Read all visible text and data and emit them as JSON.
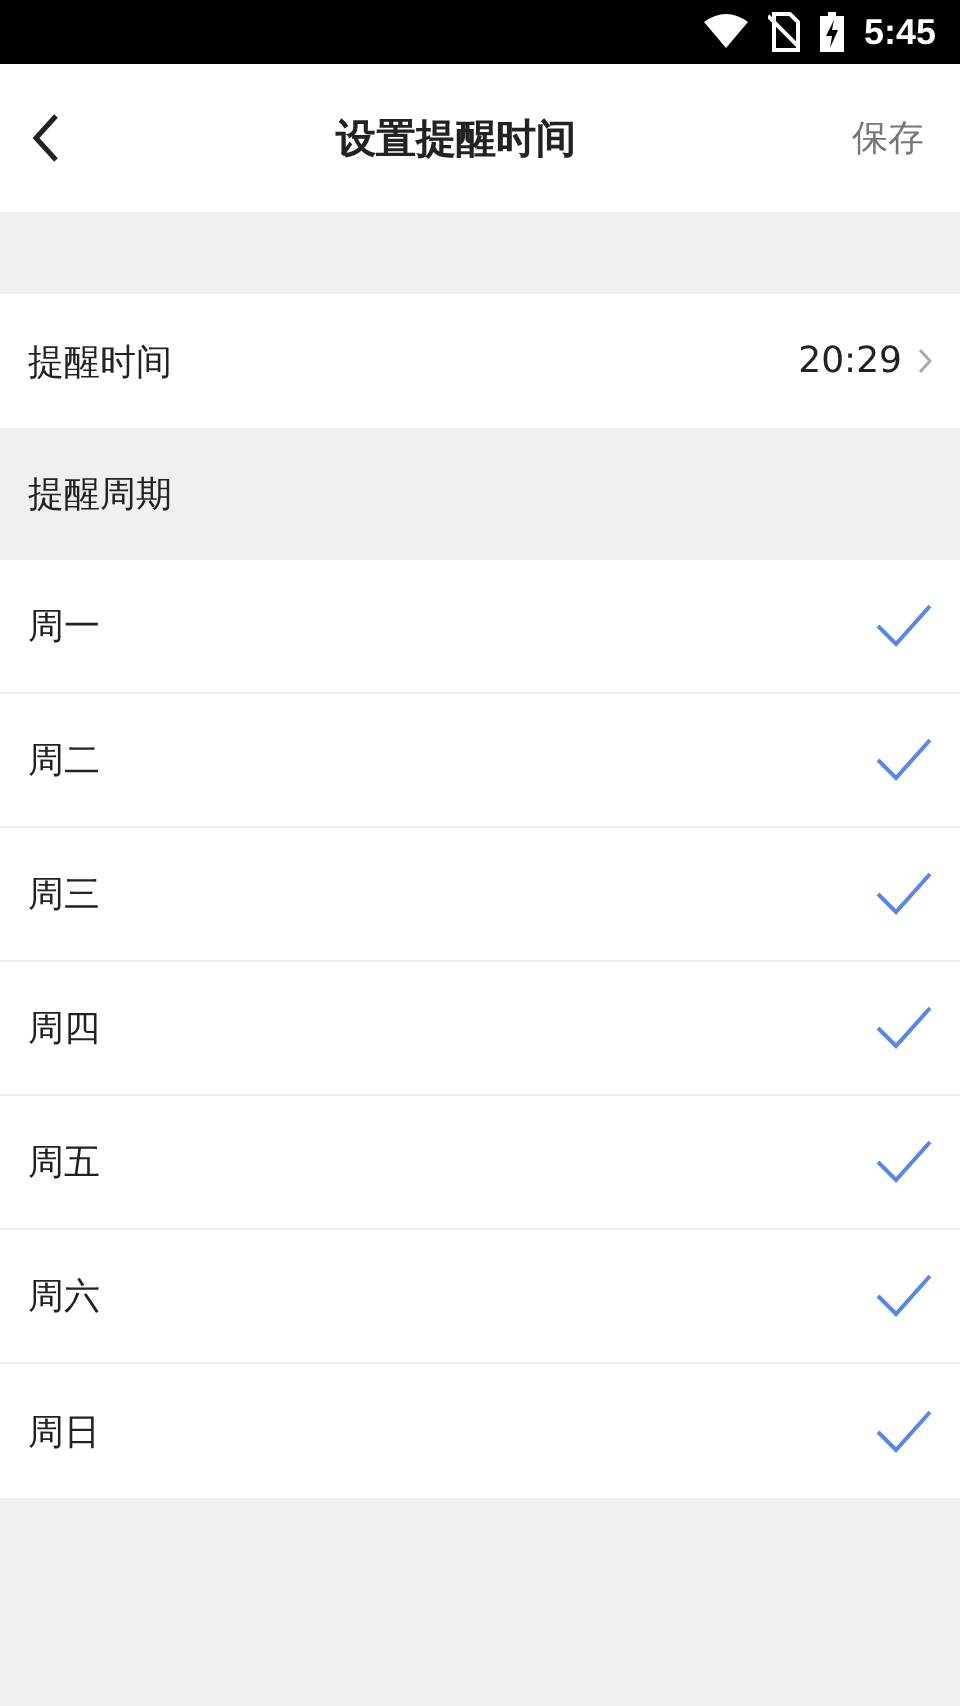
{
  "status_bar": {
    "time": "5:45"
  },
  "header": {
    "title": "设置提醒时间",
    "save": "保存"
  },
  "reminder_time": {
    "label": "提醒时间",
    "value": "20:29"
  },
  "cycle_section": {
    "title": "提醒周期"
  },
  "days": [
    {
      "label": "周一",
      "checked": true
    },
    {
      "label": "周二",
      "checked": true
    },
    {
      "label": "周三",
      "checked": true
    },
    {
      "label": "周四",
      "checked": true
    },
    {
      "label": "周五",
      "checked": true
    },
    {
      "label": "周六",
      "checked": true
    },
    {
      "label": "周日",
      "checked": true
    }
  ]
}
